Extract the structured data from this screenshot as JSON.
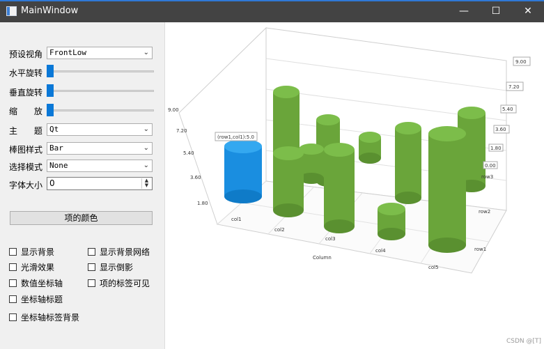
{
  "window": {
    "title": "MainWindow",
    "minimize": "—",
    "maximize": "☐",
    "close": "✕"
  },
  "panel": {
    "preset_label": "预设视角",
    "preset_value": "FrontLow",
    "hrot_label": "水平旋转",
    "vrot_label": "垂直旋转",
    "zoom_label": "缩 放",
    "theme_label": "主 题",
    "theme_value": "Qt",
    "bar_style_label": "棒图样式",
    "bar_style_value": "Bar",
    "select_mode_label": "选择模式",
    "select_mode_value": "None",
    "font_size_label": "字体大小",
    "font_size_value": "0",
    "item_color_button": "项的颜色",
    "checkboxes": {
      "show_background": "显示背景",
      "show_bg_grid": "显示背景网络",
      "smooth": "光滑效果",
      "show_reflection": "显示倒影",
      "value_axis": "数值坐标轴",
      "item_labels_visible": "项的标签可见",
      "axis_titles": "坐标轴标题",
      "axis_label_background": "坐标轴标签背景"
    }
  },
  "chart": {
    "selection_label": "(row1,col1):5.0",
    "value_ticks": [
      "9.00",
      "7.20",
      "5.40",
      "3.60",
      "1.80",
      "0.00"
    ],
    "left_ticks": [
      "9.00",
      "7.20",
      "5.40",
      "3.60",
      "1.80"
    ],
    "row_labels": [
      "row1",
      "row2",
      "row3"
    ],
    "col_labels": [
      "col1",
      "col2",
      "col3",
      "col4",
      "col5"
    ],
    "column_axis_title": "Column",
    "colors": {
      "bar": "#6aa53a",
      "bar_top": "#78b846",
      "selected": "#1a8ee0",
      "selected_top": "#2ea3ee"
    },
    "watermark": "CSDN @[T]"
  }
}
